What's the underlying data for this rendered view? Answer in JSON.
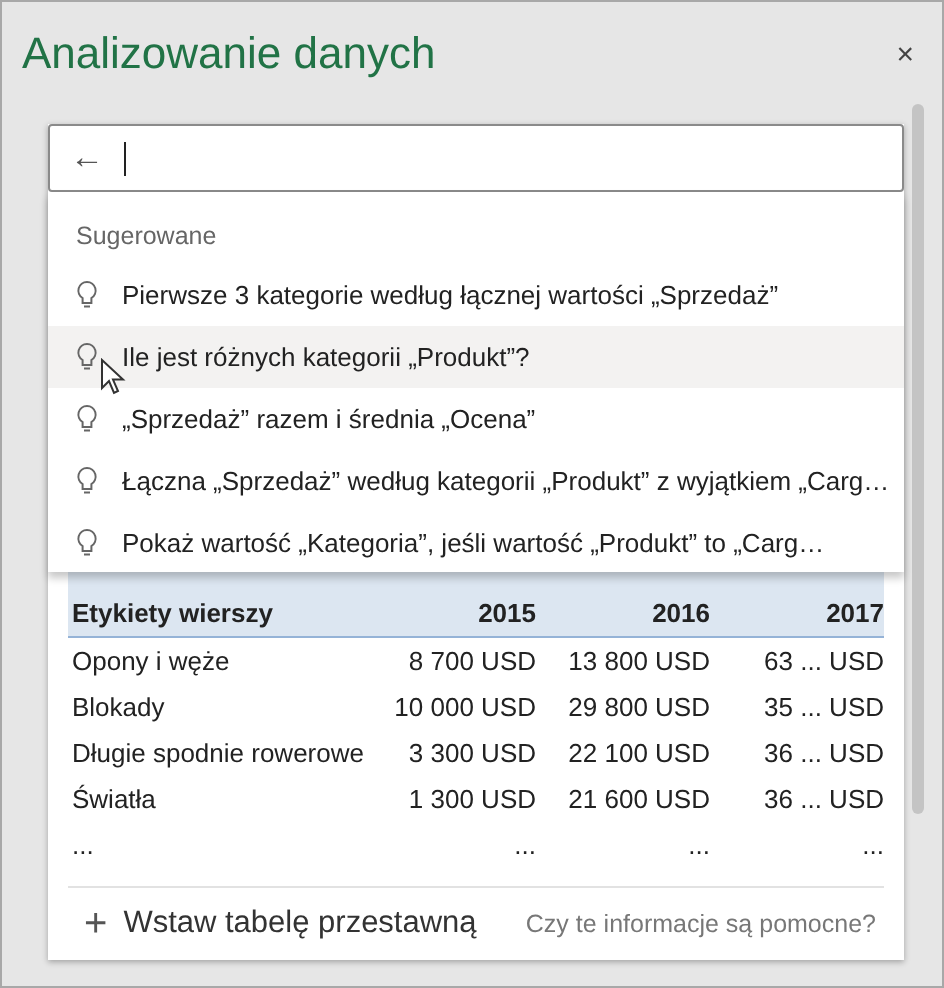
{
  "pane": {
    "title": "Analizowanie danych",
    "close": "×"
  },
  "search": {
    "back": "←"
  },
  "suggestions": {
    "heading": "Sugerowane",
    "items": [
      {
        "text": "Pierwsze 3 kategorie według łącznej wartości „Sprzedaż”",
        "highlighted": false
      },
      {
        "text": "Ile jest różnych kategorii „Produkt”?",
        "highlighted": true
      },
      {
        "text": "„Sprzedaż” razem i średnia „Ocena”",
        "highlighted": false
      },
      {
        "text": "Łączna „Sprzedaż” według kategorii „Produkt” z wyjątkiem „Carg…",
        "highlighted": false
      },
      {
        "text": "Pokaż wartość „Kategoria”, jeśli wartość „Produkt” to „Carg…",
        "highlighted": false
      }
    ]
  },
  "table": {
    "columns": [
      "Etykiety wierszy",
      "2015",
      "2016",
      "2017"
    ],
    "rows": [
      [
        "Opony i węże",
        "8 700 USD",
        "13 800 USD",
        "63 ... USD"
      ],
      [
        "Blokady",
        "10 000 USD",
        "29 800 USD",
        "35 ... USD"
      ],
      [
        "Długie spodnie rowerowe",
        "3 300 USD",
        "22 100 USD",
        "36 ... USD"
      ],
      [
        "Światła",
        "1 300 USD",
        "21 600 USD",
        "36 ... USD"
      ],
      [
        "...",
        "...",
        "...",
        "..."
      ]
    ]
  },
  "footer": {
    "insert": "+",
    "insert_label": "Wstaw tabelę przestawną",
    "feedback": "Czy te informacje są pomocne?"
  }
}
